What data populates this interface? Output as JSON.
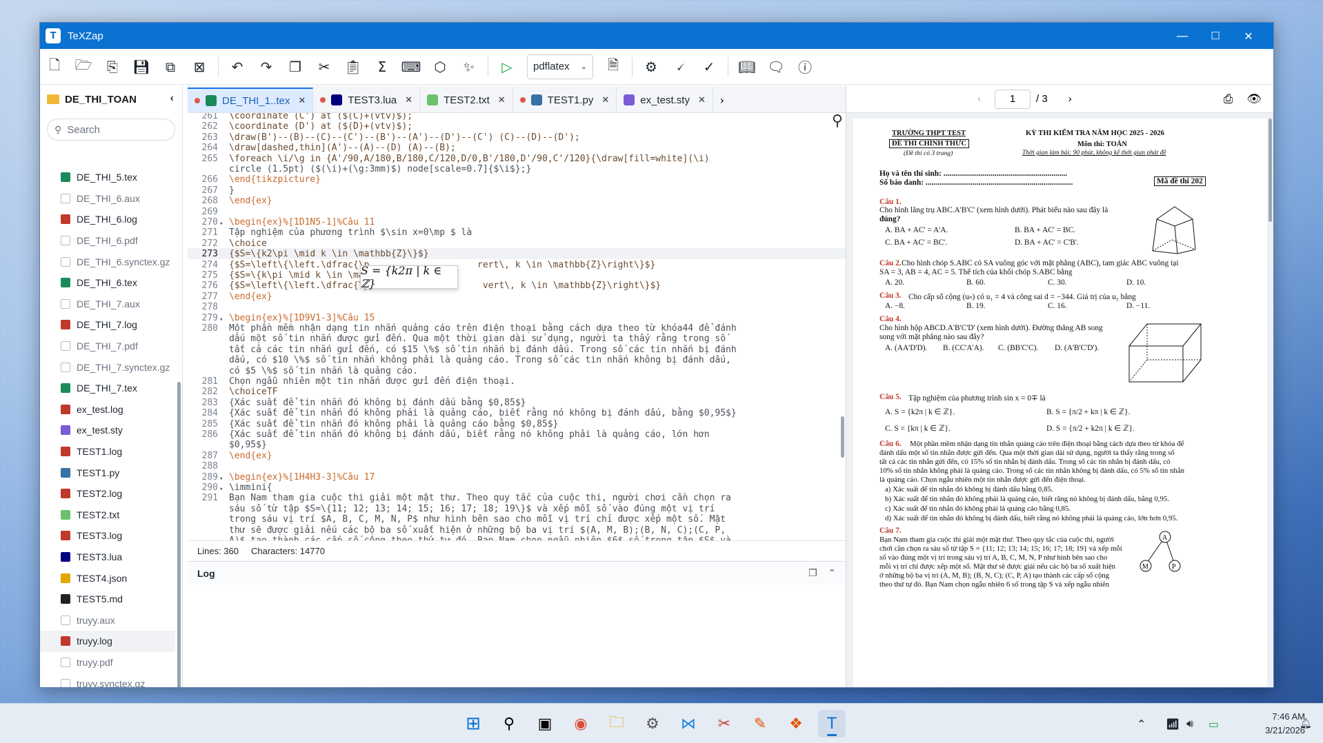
{
  "window": {
    "title": "TeXZap",
    "min": "—",
    "max": "☐",
    "close": "✕"
  },
  "toolbar": {
    "engine": "pdflatex"
  },
  "sidebar": {
    "folder": "DE_THI_TOAN",
    "search_placeholder": "Search",
    "files": [
      {
        "name": "DE_THI_5.tex",
        "kind": "tex"
      },
      {
        "name": "DE_THI_6.aux",
        "kind": "aux"
      },
      {
        "name": "DE_THI_6.log",
        "kind": "log"
      },
      {
        "name": "DE_THI_6.pdf",
        "kind": "aux"
      },
      {
        "name": "DE_THI_6.synctex.gz",
        "kind": "aux"
      },
      {
        "name": "DE_THI_6.tex",
        "kind": "tex"
      },
      {
        "name": "DE_THI_7.aux",
        "kind": "aux"
      },
      {
        "name": "DE_THI_7.log",
        "kind": "log"
      },
      {
        "name": "DE_THI_7.pdf",
        "kind": "aux"
      },
      {
        "name": "DE_THI_7.synctex.gz",
        "kind": "aux"
      },
      {
        "name": "DE_THI_7.tex",
        "kind": "tex"
      },
      {
        "name": "ex_test.log",
        "kind": "log"
      },
      {
        "name": "ex_test.sty",
        "kind": "sty"
      },
      {
        "name": "TEST1.log",
        "kind": "log"
      },
      {
        "name": "TEST1.py",
        "kind": "py"
      },
      {
        "name": "TEST2.log",
        "kind": "log"
      },
      {
        "name": "TEST2.txt",
        "kind": "txt"
      },
      {
        "name": "TEST3.log",
        "kind": "log"
      },
      {
        "name": "TEST3.lua",
        "kind": "lua"
      },
      {
        "name": "TEST4.json",
        "kind": "json"
      },
      {
        "name": "TEST5.md",
        "kind": "md"
      },
      {
        "name": "truyy.aux",
        "kind": "aux"
      },
      {
        "name": "truyy.log",
        "kind": "log"
      },
      {
        "name": "truyy.pdf",
        "kind": "aux"
      },
      {
        "name": "truyy.synctex.gz",
        "kind": "aux"
      },
      {
        "name": "truyy.tex",
        "kind": "tex"
      }
    ]
  },
  "tabs": [
    {
      "label": "DE_THI_1..tex",
      "kind": "tex",
      "active": true
    },
    {
      "label": "TEST3.lua",
      "kind": "lua"
    },
    {
      "label": "TEST2.txt",
      "kind": "txt"
    },
    {
      "label": "TEST1.py",
      "kind": "py"
    },
    {
      "label": "ex_test.sty",
      "kind": "sty"
    }
  ],
  "editor": {
    "lines": [
      {
        "n": "261",
        "t": "\\coordinate (C') at ($(C)+(vtv)$);"
      },
      {
        "n": "262",
        "t": "\\coordinate (D') at ($(D)+(vtv)$);"
      },
      {
        "n": "263",
        "t": "\\draw(B')--(B)--(C)--(C')--(B')--(A')--(D')--(C') (C)--(D)--(D');"
      },
      {
        "n": "264",
        "t": "\\draw[dashed,thin](A')--(A)--(D) (A)--(B);"
      },
      {
        "n": "265",
        "t": "\\foreach \\i/\\g in {A'/90,A/180,B/180,C/120,D/0,B'/180,D'/90,C'/120}{\\draw[fill=white](\\i)"
      },
      {
        "n": "",
        "t": "circle (1.5pt) ($(\\i)+(\\g:3mm)$) node[scale=0.7]{$\\i$};}"
      },
      {
        "n": "266",
        "t": "\\end{tikzpicture}"
      },
      {
        "n": "267",
        "t": "}"
      },
      {
        "n": "268",
        "t": "\\end{ex}"
      },
      {
        "n": "269",
        "t": ""
      },
      {
        "n": "270",
        "t": "\\begin{ex}%[1D1N5-1]%Câu 11",
        "fold": true
      },
      {
        "n": "271",
        "t": "Tập nghiệm của phương trình $\\sin x=0\\mp $ là"
      },
      {
        "n": "272",
        "t": "\\choice"
      },
      {
        "n": "273",
        "t": "{$S=\\{k2\\pi \\mid k \\in \\mathbb{Z}\\}$}",
        "cur": true
      },
      {
        "n": "274",
        "t": "{$S=\\left\\{\\left.\\dfrac{\\p                    rert\\, k \\in \\mathbb{Z}\\right\\}$}"
      },
      {
        "n": "275",
        "t": "{$S=\\{k\\pi \\mid k \\in \\mat"
      },
      {
        "n": "276",
        "t": "{$S=\\left\\{\\left.\\dfrac{\\p                     vert\\, k \\in \\mathbb{Z}\\right\\}$}"
      },
      {
        "n": "277",
        "t": "\\end{ex}"
      },
      {
        "n": "278",
        "t": ""
      },
      {
        "n": "279",
        "t": "\\begin{ex}%[1D9V1-3]%Câu 15",
        "fold": true
      },
      {
        "n": "280",
        "t": "Một phần mềm nhận dạng tin nhắn quảng cáo trên điện thoại bằng cách dựa theo từ khóa44 để đánh"
      },
      {
        "n": "",
        "t": "dấu một số tin nhắn được gửi đến. Qua một thời gian dài sử dụng, người ta thấy rằng trong số"
      },
      {
        "n": "",
        "t": "tất cả các tin nhắn gửi đến, có $15 \\%$ số tin nhắn bị đánh dấu. Trong số các tin nhắn bị đánh"
      },
      {
        "n": "",
        "t": "dấu, có $10 \\%$ số tin nhắn không phải là quảng cáo. Trong số các tin nhắn không bị đánh dấu,"
      },
      {
        "n": "",
        "t": "có $5 \\%$ số tin nhắn là quảng cáo."
      },
      {
        "n": "281",
        "t": "Chọn ngẫu nhiên một tin nhắn được gửi đến điện thoại."
      },
      {
        "n": "282",
        "t": "\\choiceTF"
      },
      {
        "n": "283",
        "t": "{Xác suất để tin nhắn đó không bị đánh dấu bằng $0,85$}"
      },
      {
        "n": "284",
        "t": "{Xác suất để tin nhắn đó không phải là quảng cáo, biết rằng nó không bị đánh dấu, bằng $0,95$}"
      },
      {
        "n": "285",
        "t": "{Xác suất để tin nhắn đó không phải là quảng cáo bằng $0,85$}"
      },
      {
        "n": "286",
        "t": "{Xác suất để tin nhắn đó không bị đánh dấu, biết rằng nó không phải là quảng cáo, lớn hơn"
      },
      {
        "n": "",
        "t": "$0,95$}"
      },
      {
        "n": "287",
        "t": "\\end{ex}"
      },
      {
        "n": "288",
        "t": ""
      },
      {
        "n": "289",
        "t": "\\begin{ex}%[1H4H3-3]%Câu 17",
        "fold": true
      },
      {
        "n": "290",
        "t": "\\immini{",
        "fold": true
      },
      {
        "n": "291",
        "t": "Bạn Nam tham gia cuộc thi giải một mật thư. Theo quy tắc của cuộc thi, người chơi cần chọn ra"
      },
      {
        "n": "",
        "t": "sáu số từ tập $S=\\{11; 12; 13; 14; 15; 16; 17; 18; 19\\}$ và xếp mỗi số vào đúng một vị trí"
      },
      {
        "n": "",
        "t": "trong sáu vị trí $A, B, C, M, N, P$ như hình bên sao cho mỗi vị trí chỉ được xếp một số. Mật"
      },
      {
        "n": "",
        "t": "thư sẽ được giải nếu các bộ ba số xuất hiện ở những bộ ba vị trí $(A, M, B);(B, N, C);(C, P,"
      },
      {
        "n": "",
        "t": "A)$ tạo thành các cấp số cộng theo thứ tự đó. Bạn Nam chọn ngẫu nhiên $6$ số trong tập $S$ và"
      }
    ],
    "popup": "S = {k2π | k ∈ ℤ}"
  },
  "status": {
    "lines": "Lines: 360",
    "chars": "Characters: 14770"
  },
  "log": {
    "label": "Log"
  },
  "pdf": {
    "page": "1",
    "of": "/ 3",
    "school": "TRƯỜNG THPT TEST",
    "official": "ĐỀ THI CHÍNH THỨC",
    "pages_note": "(Đề thi có 3 trang)",
    "exam": "KỲ THI KIỂM TRA NĂM HỌC 2025 - 2026",
    "subject": "Môn thi: TOÁN",
    "time": "Thời gian làm bài: 90 phút, không kể thời gian phát đề",
    "name": "Họ và tên thí sinh: ...............................................................",
    "sbd": "Số báo danh: ...........................................................................",
    "code": "Mã đề thi 202",
    "q1": "Câu 1.",
    "q1t": "Cho hình lăng trụ ABC.A'B'C' (xem hình dưới). Phát biểu nào sau đây là",
    "q1t2": "đúng?",
    "q1a": "A. BA + AC' = A'A.",
    "q1b": "B. BA + AC' = BC.",
    "q1c": "C. BA + AC' = BC'.",
    "q1d": "D. BA + AC' = C'B'.",
    "q2": "Câu 2.",
    "q2t": "Cho hình chóp S.ABC có SA vuông góc với mặt phẳng (ABC), tam giác ABC vuông tại",
    "q2t2": "SA = 3, AB = 4, AC = 5. Thể tích của khối chóp S.ABC bằng",
    "q2a": "A. 20.",
    "q2b": "B. 60.",
    "q2c": "C. 30.",
    "q2d": "D. 10.",
    "q3": "Câu 3.",
    "q3t": "Cho cấp số cộng (uₙ) có u₁ = 4 và công sai d = −344. Giá trị của u₅ bằng",
    "q3a": "A. −8.",
    "q3b": "B. 19.",
    "q3c": "C. 16.",
    "q3d": "D. −11.",
    "q4": "Câu 4.",
    "q4t": "Cho hình hộp ABCD.A'B'C'D' (xem hình dưới). Đường thẳng AB song",
    "q4t2": "song với mặt phẳng nào sau đây?",
    "q4a": "A. (AA'D'D).",
    "q4b": "B. (CC'A'A).",
    "q4c": "C. (BB'C'C).",
    "q4d": "D. (A'B'C'D').",
    "q5": "Câu 5.",
    "q5t": "Tập nghiệm của phương trình sin x = 0∓ là",
    "q5a": "A. S = {k2π | k ∈ ℤ}.",
    "q5b": "B. S = {π/2 + kπ | k ∈ ℤ}.",
    "q5c": "C. S = {kπ | k ∈ ℤ}.",
    "q5d": "D. S = {π/2 + k2π | k ∈ ℤ}.",
    "q6": "Câu 6.",
    "q6t1": "Một phần mềm nhận dạng tin nhắn quảng cáo trên điện thoại bằng cách dựa theo từ khóa để",
    "q6t2": "đánh dấu một số tin nhắn được gửi đến. Qua một thời gian dài sử dụng, người ta thấy rằng trong số",
    "q6t3": "tất cả các tin nhắn gửi đến, có 15% số tin nhắn bị đánh dấu. Trong số các tin nhắn bị đánh dấu, có",
    "q6t4": "10% số tin nhắn không phải là quảng cáo. Trong số các tin nhắn không bị đánh dấu, có 5% số tin nhắn",
    "q6t5": "là quảng cáo. Chọn ngẫu nhiên một tin nhắn được gửi đến điện thoại.",
    "q6a": "a)  Xác suất để tin nhắn đó không bị đánh dấu bằng 0,85.",
    "q6b": "b)  Xác suất để tin nhắn đó không phải là quảng cáo, biết rằng nó không bị đánh dấu, bằng 0,95.",
    "q6c": "c)  Xác suất để tin nhắn đó không phải là quảng cáo bằng 0,85.",
    "q6d": "d)  Xác suất để tin nhắn đó không bị đánh dấu, biết rằng nó không phải là quảng cáo, lớn hơn 0,95.",
    "q7": "Câu 7.",
    "q7t1": "Bạn Nam tham gia cuộc thi giải một mật thư. Theo quy tắc của cuộc thi, người",
    "q7t2": "chơi cần chọn ra sáu số từ tập S = {11; 12; 13; 14; 15; 16; 17; 18; 19} và xếp mỗi",
    "q7t3": "số vào đúng một vị trí trong sáu vị trí A, B, C, M, N, P như hình bên sao cho",
    "q7t4": "mỗi vị trí chỉ được xếp một số. Mật thư sẽ được giải nếu các bộ ba số xuất hiện",
    "q7t5": "ở những bộ ba vị trí (A, M, B); (B, N, C); (C, P, A) tạo thành các cấp số cộng",
    "q7t6": "theo thứ tự đó. Bạn Nam chọn ngẫu nhiên 6 số trong tập S và xếp ngẫu nhiên"
  },
  "taskbar": {
    "time": "7:46 AM",
    "date": "3/21/2026"
  },
  "colors": {
    "accent": "#0a72d1",
    "play": "#18a84b",
    "pdf_red": "#c0392b"
  }
}
